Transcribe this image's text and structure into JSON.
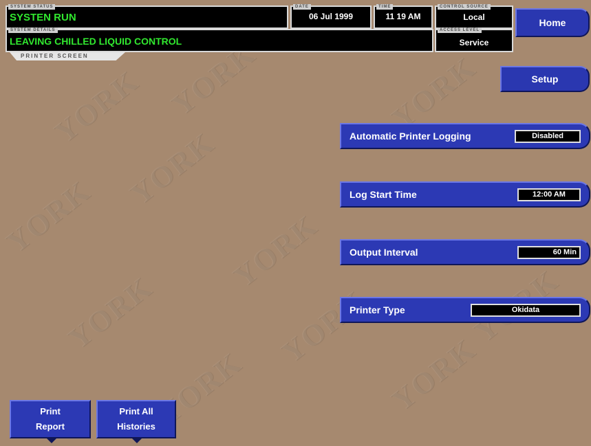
{
  "status": {
    "system_status_caption": "SYSTEM STATUS",
    "system_status": "SYSTEN RUN",
    "system_details_caption": "SYSTEM DETAILS",
    "system_details": "LEAVING CHILLED LIQUID CONTROL",
    "date_caption": "DATE",
    "date": "06 Jul 1999",
    "time_caption": "TIME",
    "time": "11 19 AM",
    "control_source_caption": "CONTROL SOURCE",
    "control_source": "Local",
    "access_level_caption": "ACCESS LEVEL",
    "access_level": "Service"
  },
  "screen_tab": "PRINTER SCREEN",
  "nav": {
    "home": "Home",
    "setup": "Setup"
  },
  "settings": [
    {
      "label": "Automatic Printer Logging",
      "value": "Disabled"
    },
    {
      "label": "Log Start Time",
      "value": "12:00 AM"
    },
    {
      "label": "Output Interval",
      "value": "60 Min"
    },
    {
      "label": "Printer Type",
      "value": "Okidata"
    }
  ],
  "bottom_buttons": [
    {
      "line1": "Print",
      "line2": "Report"
    },
    {
      "line1": "Print All",
      "line2": "Histories"
    }
  ],
  "watermark": "YORK",
  "colors": {
    "background": "#a6896f",
    "button_blue": "#2c39b4",
    "status_green": "#31e82f"
  }
}
